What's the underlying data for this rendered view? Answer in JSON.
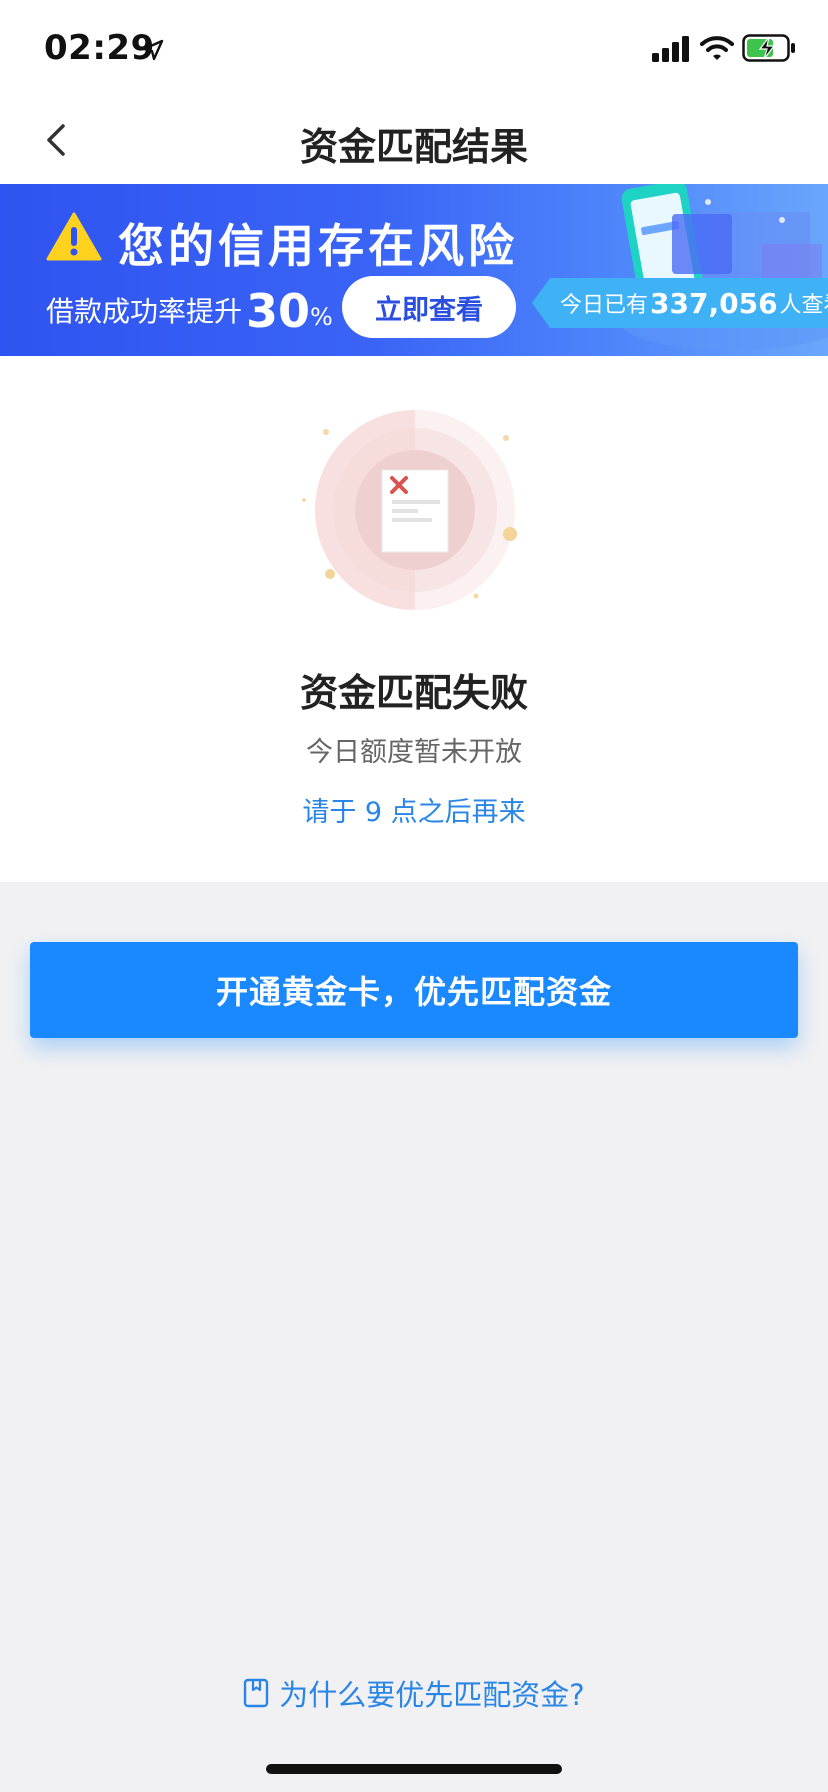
{
  "status_bar": {
    "time": "02:29",
    "icons": [
      "location-arrow-icon",
      "signal-icon",
      "wifi-icon",
      "battery-charging-icon"
    ]
  },
  "nav": {
    "title": "资金匹配结果",
    "back_icon": "chevron-left-icon"
  },
  "banner": {
    "headline": "您的信用存在风险",
    "sub_text": "借款成功率提升",
    "rate_value": "30",
    "rate_unit": "%",
    "button_label": "立即查看",
    "ribbon_prefix": "今日已有",
    "ribbon_count": "337,056",
    "ribbon_suffix": "人查看",
    "accent_color": "#2f53f0",
    "ribbon_color": "#3fb2f6"
  },
  "result": {
    "title": "资金匹配失败",
    "description": "今日额度暂未开放",
    "hint": "请于 9 点之后再来",
    "hint_color": "#2a86e6"
  },
  "cta": {
    "label": "开通黄金卡，优先匹配资金",
    "color": "#1a88ff"
  },
  "footer": {
    "link_label": "为什么要优先匹配资金?",
    "link_icon": "bookmark-icon"
  }
}
